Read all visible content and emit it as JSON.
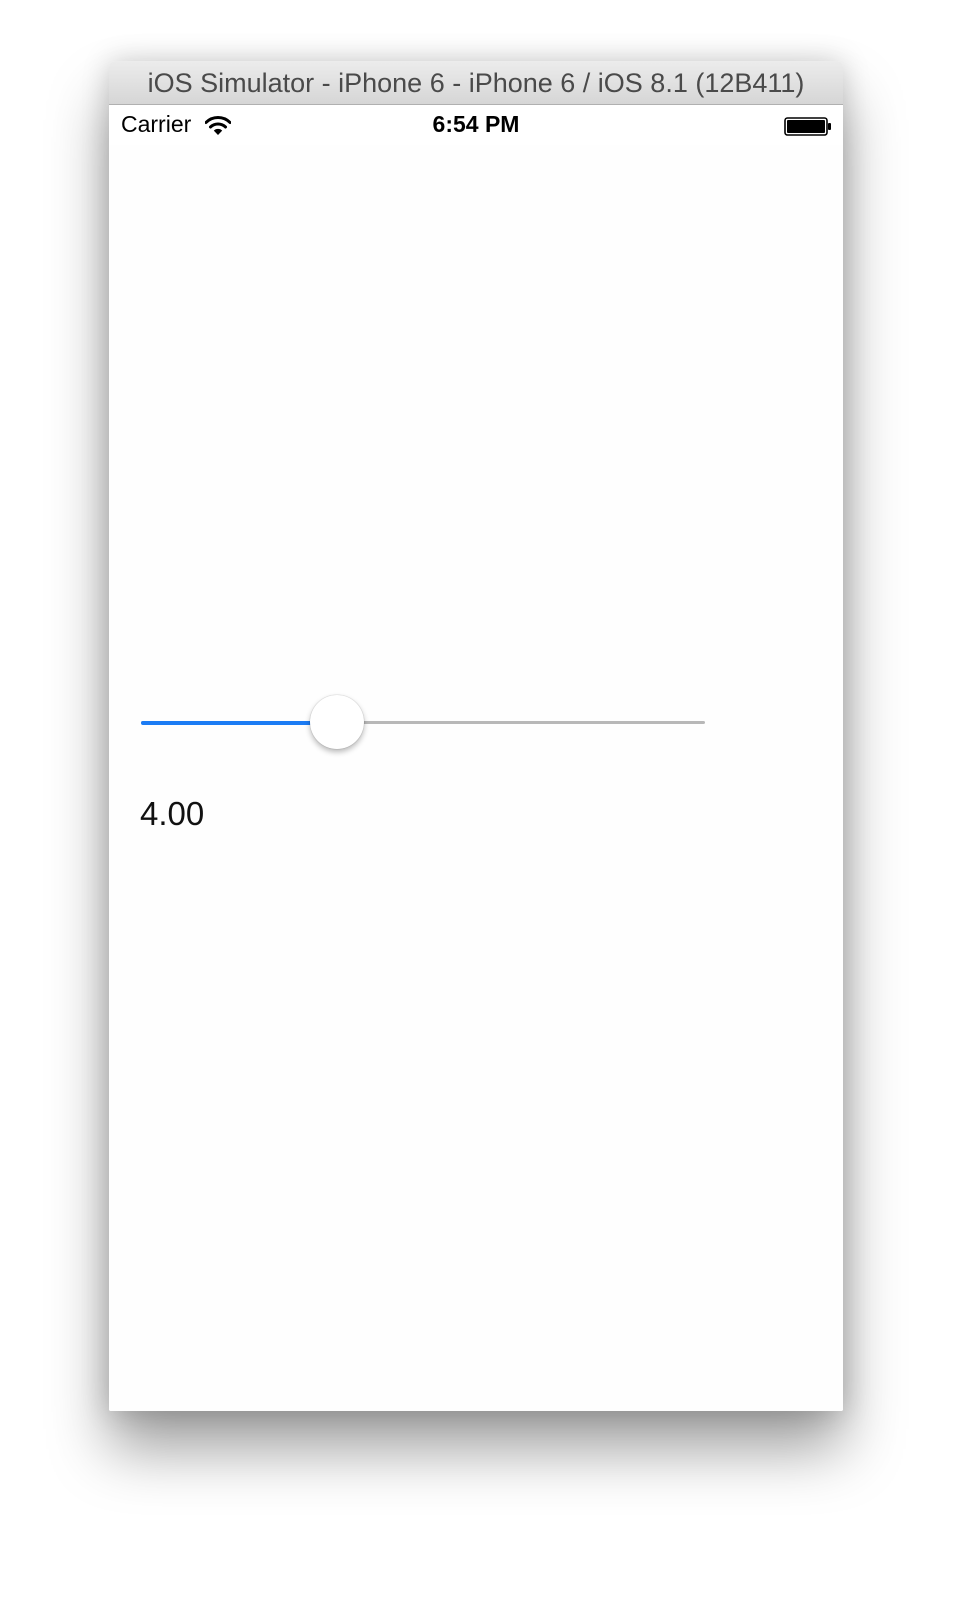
{
  "window": {
    "title": "iOS Simulator - iPhone 6 - iPhone 6 / iOS 8.1 (12B411)"
  },
  "status_bar": {
    "carrier": "Carrier",
    "time": "6:54 PM",
    "wifi_icon": "wifi-icon",
    "battery_icon": "battery-icon"
  },
  "slider": {
    "fill_fraction": 0.348,
    "min_track_color": "#1c7cf4",
    "max_track_color": "#b8b8b8"
  },
  "value_label": "4.00"
}
